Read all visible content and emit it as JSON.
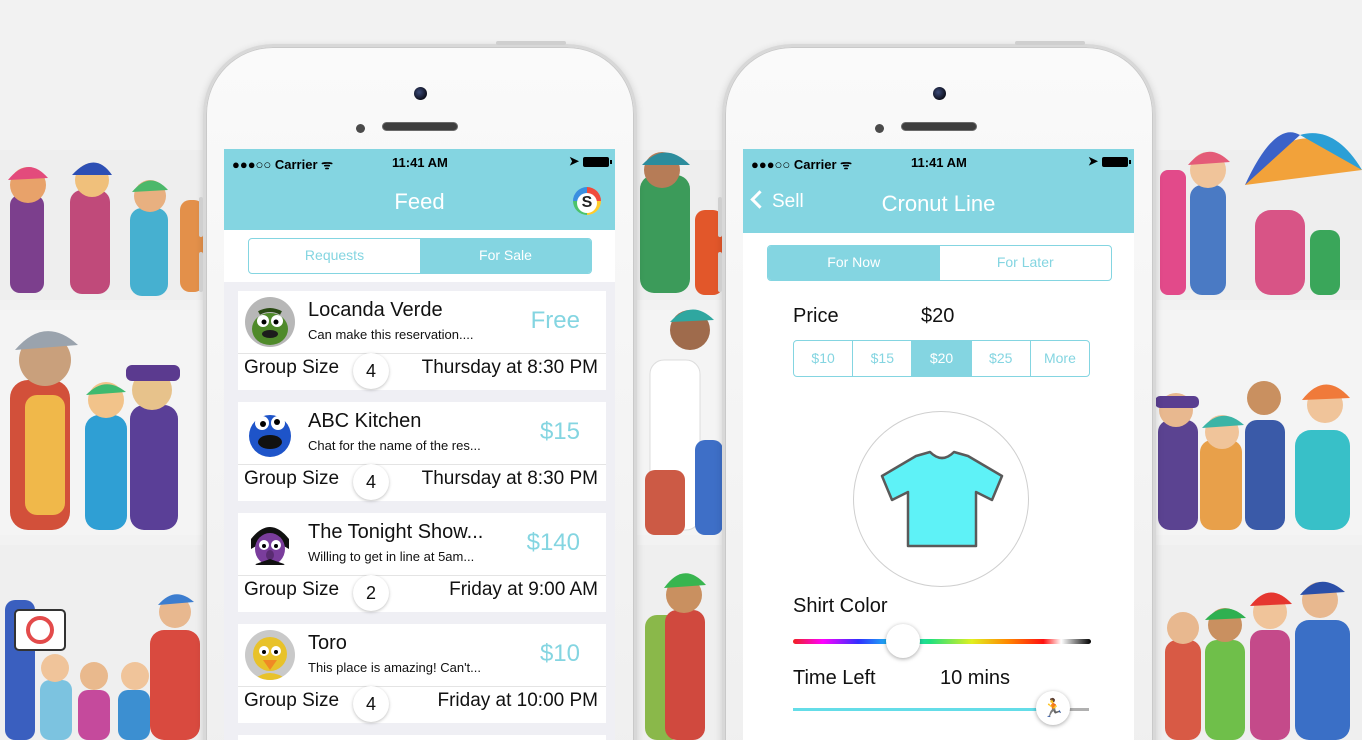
{
  "status_bar": {
    "carrier": "●●●○○ Carrier ᯤ",
    "time": "11:41 AM",
    "location_icon": "location-arrow-icon",
    "battery_icon": "battery-icon"
  },
  "feed_screen": {
    "title": "Feed",
    "logo_letter": "S",
    "tabs": [
      {
        "label": "Requests",
        "selected": false
      },
      {
        "label": "For Sale",
        "selected": true
      }
    ],
    "items": [
      {
        "title": "Locanda Verde",
        "desc": "Can make this reservation....",
        "price": "Free",
        "group_size_label": "Group Size",
        "group_size": "4",
        "when": "Thursday at 8:30 PM",
        "avatar": "oscar-avatar"
      },
      {
        "title": "ABC Kitchen",
        "desc": "Chat for the name of the res...",
        "price": "$15",
        "group_size_label": "Group Size",
        "group_size": "4",
        "when": "Thursday at 8:30 PM",
        "avatar": "cookie-monster-avatar"
      },
      {
        "title": "The Tonight Show...",
        "desc": "Willing to get in line at 5am...",
        "price": "$140",
        "group_size_label": "Group Size",
        "group_size": "2",
        "when": "Friday at 9:00 AM",
        "avatar": "count-avatar"
      },
      {
        "title": "Toro",
        "desc": "This place is amazing! Can't...",
        "price": "$10",
        "group_size_label": "Group Size",
        "group_size": "4",
        "when": "Friday at 10:00 PM",
        "avatar": "big-bird-avatar"
      }
    ]
  },
  "sell_screen": {
    "back_label": "Sell",
    "title": "Cronut Line",
    "tabs": [
      {
        "label": "For Now",
        "selected": true
      },
      {
        "label": "For Later",
        "selected": false
      }
    ],
    "price_label": "Price",
    "price_value": "$20",
    "price_options": [
      {
        "label": "$10",
        "selected": false
      },
      {
        "label": "$15",
        "selected": false
      },
      {
        "label": "$20",
        "selected": true
      },
      {
        "label": "$25",
        "selected": false
      },
      {
        "label": "More",
        "selected": false
      }
    ],
    "shirt_color": "#5ef2f7",
    "shirt_color_label": "Shirt Color",
    "shirt_color_slider_position": 0.37,
    "time_left_label": "Time Left",
    "time_left_value": "10 mins",
    "time_left_slider_position": 0.88,
    "time_thumb_icon": "running-person-icon"
  },
  "colors": {
    "accent": "#84d5e1",
    "feed_background": "#efeff4"
  }
}
